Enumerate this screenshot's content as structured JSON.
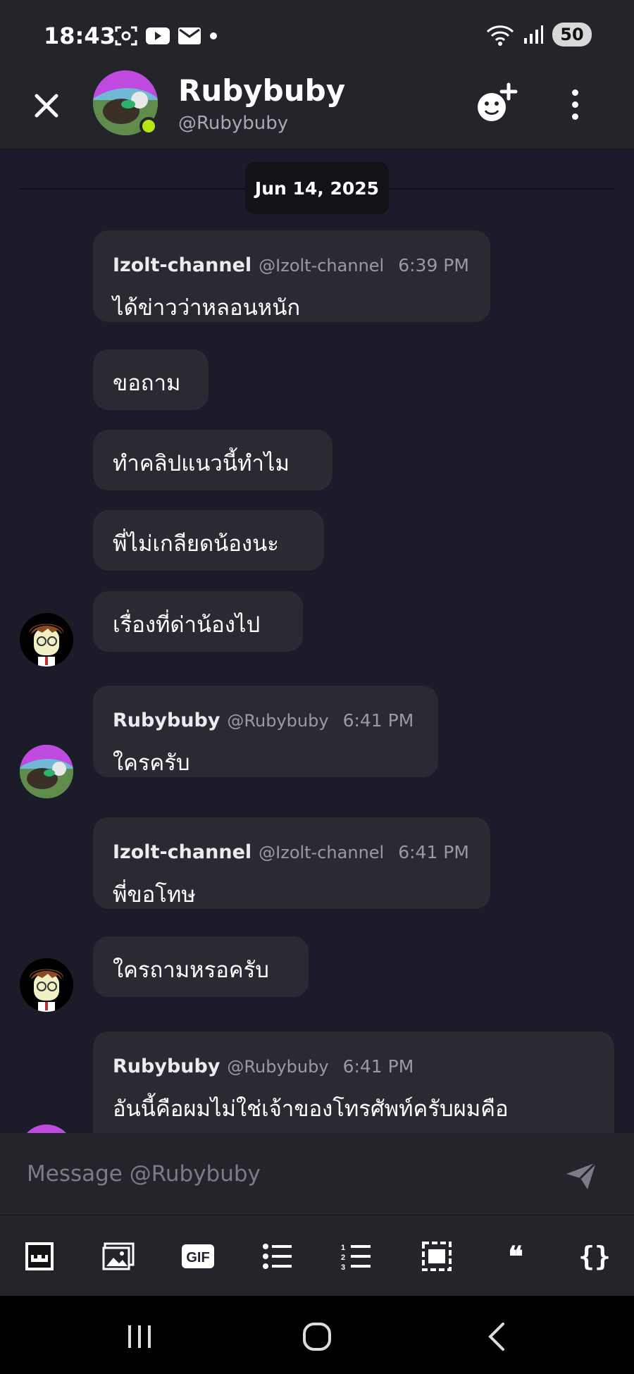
{
  "status_bar": {
    "time": "18:43",
    "battery": "50"
  },
  "header": {
    "name": "Rubybuby",
    "handle": "@Rubybuby"
  },
  "chat": {
    "date_divider": "Jun 14, 2025",
    "messages": [
      {
        "user": "Izolt-channel",
        "handle": "@Izolt-channel",
        "time": "6:39 PM",
        "text": "ได้ข่าวว่าหลอนหนัก"
      },
      {
        "text": "ขอถาม"
      },
      {
        "text": "ทำคลิปแนวนี้ทำไม"
      },
      {
        "text": "พี่ไม่เกลียดน้องนะ"
      },
      {
        "text": "เรื่องที่ด่าน้องไป"
      },
      {
        "user": "Rubybuby",
        "handle": "@Rubybuby",
        "time": "6:41 PM",
        "text": "ใครครับ"
      },
      {
        "user": "Izolt-channel",
        "handle": "@Izolt-channel",
        "time": "6:41 PM",
        "text": "พี่ขอโทษ"
      },
      {
        "text": "ใครถามหรอครับ"
      },
      {
        "user": "Rubybuby",
        "handle": "@Rubybuby",
        "time": "6:41 PM",
        "text": "อันนี้คือผมไม่ใช่เจ้าของโทรศัพท์ครับผมคือ"
      }
    ]
  },
  "composer": {
    "placeholder": "Message @Rubybuby"
  },
  "toolbar": {
    "gif_label": "GIF",
    "quote_label": "❝",
    "code_label": "{}"
  },
  "colors": {
    "background": "#1c1b29",
    "bubble": "#2a2a32",
    "online": "#b8e614"
  }
}
